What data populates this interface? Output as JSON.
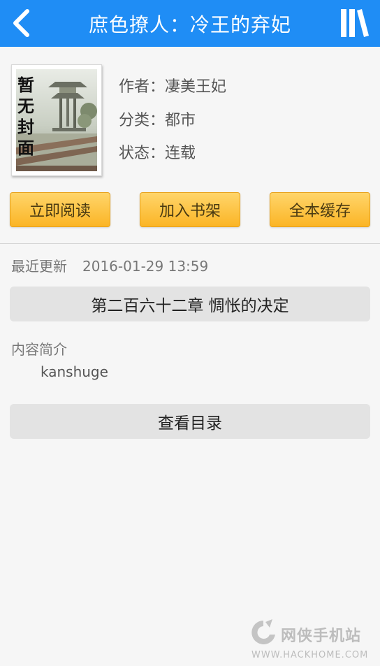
{
  "header": {
    "title": "庶色撩人：冷王的弃妃"
  },
  "book": {
    "cover_text": "暂无封面",
    "author": "作者：凄美王妃",
    "category": "分类：都市",
    "status": "状态：连载"
  },
  "actions": {
    "read_label": "立即阅读",
    "add_shelf_label": "加入书架",
    "cache_label": "全本缓存"
  },
  "update": {
    "label": "最近更新",
    "time": "2016-01-29 13:59",
    "latest_chapter": "第二百六十二章 惆怅的决定"
  },
  "intro": {
    "label": "内容简介",
    "text": "kanshuge"
  },
  "toc": {
    "label": "查看目录"
  },
  "watermark": {
    "name": "网侠手机站",
    "url": "WWW.HACKHOME.COM"
  },
  "colors": {
    "header_bg": "#1f8df5",
    "button_gold": "#fbb526",
    "background": "#f6f6f6"
  },
  "icons": {
    "back": "chevron-left-icon",
    "shelf": "bookshelf-icon"
  }
}
